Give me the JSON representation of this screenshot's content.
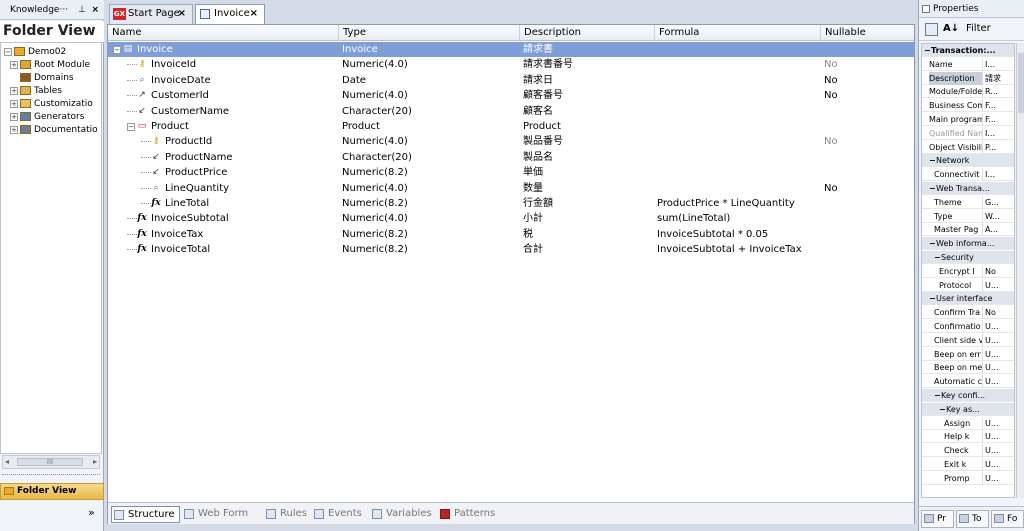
{
  "left_panel": {
    "title": "Knowledge···",
    "pin": "Ⲁ",
    "close": "×",
    "folder_view_title": "Folder View",
    "tree": [
      {
        "label": "Demo02",
        "level": 0,
        "expander": "−",
        "icon": "kb-icon"
      },
      {
        "label": "Root Module",
        "level": 1,
        "expander": "+",
        "icon": "module-icon"
      },
      {
        "label": "Domains",
        "level": 1,
        "expander": "",
        "icon": "domains-icon"
      },
      {
        "label": "Tables",
        "level": 1,
        "expander": "+",
        "icon": "tables-icon"
      },
      {
        "label": "Customizatio",
        "level": 1,
        "expander": "+",
        "icon": "folder-icon"
      },
      {
        "label": "Generators",
        "level": 1,
        "expander": "+",
        "icon": "generators-icon"
      },
      {
        "label": "Documentatio",
        "level": 1,
        "expander": "+",
        "icon": "documentation-icon"
      }
    ],
    "scroll_thumb": "III",
    "footer_label": "Folder View",
    "chevron": "»"
  },
  "tabs": [
    {
      "label": "Start Page",
      "icon": "gx-icon",
      "close": "×",
      "active": false
    },
    {
      "label": "Invoice",
      "icon": "transaction-icon",
      "close": "×",
      "active": true
    }
  ],
  "grid": {
    "columns": [
      "Name",
      "Type",
      "Description",
      "Formula",
      "Nullable"
    ],
    "rows": [
      {
        "name": "Invoice",
        "type": "Invoice",
        "desc": "請求書",
        "formula": "",
        "nullable": "",
        "level": 0,
        "icon": "transaction-icon",
        "expander": "−",
        "selected": true
      },
      {
        "name": "InvoiceId",
        "type": "Numeric(4.0)",
        "desc": "請求書番号",
        "formula": "",
        "nullable": "No",
        "level": 1,
        "icon": "key-icon",
        "null_style": "gray"
      },
      {
        "name": "InvoiceDate",
        "type": "Date",
        "desc": "請求日",
        "formula": "",
        "nullable": "No",
        "level": 1,
        "icon": "attribute-icon",
        "null_style": "black"
      },
      {
        "name": "CustomerId",
        "type": "Numeric(4.0)",
        "desc": "顧客番号",
        "formula": "",
        "nullable": "No",
        "level": 1,
        "icon": "foreign-key-icon",
        "null_style": "black"
      },
      {
        "name": "CustomerName",
        "type": "Character(20)",
        "desc": "顧客名",
        "formula": "",
        "nullable": "",
        "level": 1,
        "icon": "inferred-icon"
      },
      {
        "name": "Product",
        "type": "Product",
        "desc": "Product",
        "formula": "",
        "nullable": "",
        "level": 1,
        "icon": "level-icon",
        "expander": "−"
      },
      {
        "name": "ProductId",
        "type": "Numeric(4.0)",
        "desc": "製品番号",
        "formula": "",
        "nullable": "No",
        "level": 2,
        "icon": "key-icon",
        "null_style": "gray"
      },
      {
        "name": "ProductName",
        "type": "Character(20)",
        "desc": "製品名",
        "formula": "",
        "nullable": "",
        "level": 2,
        "icon": "inferred-icon"
      },
      {
        "name": "ProductPrice",
        "type": "Numeric(8.2)",
        "desc": "単価",
        "formula": "",
        "nullable": "",
        "level": 2,
        "icon": "inferred-icon"
      },
      {
        "name": "LineQuantity",
        "type": "Numeric(4.0)",
        "desc": "数量",
        "formula": "",
        "nullable": "No",
        "level": 2,
        "icon": "attribute-icon",
        "null_style": "black"
      },
      {
        "name": "LineTotal",
        "type": "Numeric(8.2)",
        "desc": "行金額",
        "formula": "ProductPrice * LineQuantity",
        "nullable": "",
        "level": 2,
        "icon": "formula-icon"
      },
      {
        "name": "InvoiceSubtotal",
        "type": "Numeric(4.0)",
        "desc": "小計",
        "formula": "sum(LineTotal)",
        "nullable": "",
        "level": 1,
        "icon": "formula-icon"
      },
      {
        "name": "InvoiceTax",
        "type": "Numeric(8.2)",
        "desc": "税",
        "formula": "InvoiceSubtotal * 0.05",
        "nullable": "",
        "level": 1,
        "icon": "formula-icon"
      },
      {
        "name": "InvoiceTotal",
        "type": "Numeric(8.2)",
        "desc": "合計",
        "formula": "InvoiceSubtotal + InvoiceTax",
        "nullable": "",
        "level": 1,
        "icon": "formula-icon"
      }
    ]
  },
  "bottom_tabs": [
    {
      "label": "Structure",
      "active": true
    },
    {
      "label": "Web Form",
      "active": false
    },
    {
      "label": "Rules",
      "active": false
    },
    {
      "label": "Events",
      "active": false
    },
    {
      "label": "Variables",
      "active": false
    },
    {
      "label": "Patterns",
      "active": false
    }
  ],
  "properties": {
    "title": "Properties",
    "filter_label": "Filter",
    "sort_label": "A↓",
    "rows": [
      {
        "key": "Transaction:...",
        "value": "",
        "category": true,
        "indent": 0,
        "bold": true
      },
      {
        "key": "Name",
        "value": "I...",
        "indent": 1
      },
      {
        "key": "Description",
        "value": "請求",
        "indent": 1,
        "selected": true
      },
      {
        "key": "Module/Folder",
        "value": "R...",
        "indent": 1
      },
      {
        "key": "Business Comp",
        "value": "F...",
        "indent": 1
      },
      {
        "key": "Main program",
        "value": "F...",
        "indent": 1
      },
      {
        "key": "Qualified Nam",
        "value": "I...",
        "indent": 1,
        "gray": true
      },
      {
        "key": "Object Visibilit",
        "value": "P...",
        "indent": 1
      },
      {
        "key": "Network",
        "value": "",
        "category": true,
        "indent": 1
      },
      {
        "key": "Connectivit",
        "value": "I...",
        "indent": 2
      },
      {
        "key": "Web Transa...",
        "value": "",
        "category": true,
        "indent": 1
      },
      {
        "key": "Theme",
        "value": "G...",
        "indent": 2
      },
      {
        "key": "Type",
        "value": "W...",
        "indent": 2
      },
      {
        "key": "Master Pag",
        "value": "A...",
        "indent": 2
      },
      {
        "key": "Web informa...",
        "value": "",
        "category": true,
        "indent": 1
      },
      {
        "key": "Security",
        "value": "",
        "category": true,
        "indent": 2
      },
      {
        "key": "Encrypt I",
        "value": "No",
        "indent": 3
      },
      {
        "key": "Protocol",
        "value": "U...",
        "indent": 3
      },
      {
        "key": "User interface",
        "value": "",
        "category": true,
        "indent": 1
      },
      {
        "key": "Confirm Tra",
        "value": "No",
        "indent": 2
      },
      {
        "key": "Confirmatio",
        "value": "U...",
        "indent": 2
      },
      {
        "key": "Client side v",
        "value": "U...",
        "indent": 2
      },
      {
        "key": "Beep on err",
        "value": "U...",
        "indent": 2
      },
      {
        "key": "Beep on me",
        "value": "U...",
        "indent": 2
      },
      {
        "key": "Automatic c",
        "value": "U...",
        "indent": 2
      },
      {
        "key": "Key confi...",
        "value": "",
        "category": true,
        "indent": 2
      },
      {
        "key": "Key as...",
        "value": "",
        "category": true,
        "indent": 3
      },
      {
        "key": "Assign",
        "value": "U...",
        "indent": 4
      },
      {
        "key": "Help k",
        "value": "U...",
        "indent": 4
      },
      {
        "key": "Check",
        "value": "U...",
        "indent": 4
      },
      {
        "key": "Exit k",
        "value": "U...",
        "indent": 4
      },
      {
        "key": "Promp",
        "value": "U...",
        "indent": 4
      }
    ],
    "bottom_tabs": [
      {
        "label": "Pr"
      },
      {
        "label": "To"
      },
      {
        "label": "Fo"
      }
    ]
  },
  "colors": {
    "selection": "#7f9ed8",
    "chrome": "#d4dbe6",
    "accent_gx": "#d2262e"
  }
}
